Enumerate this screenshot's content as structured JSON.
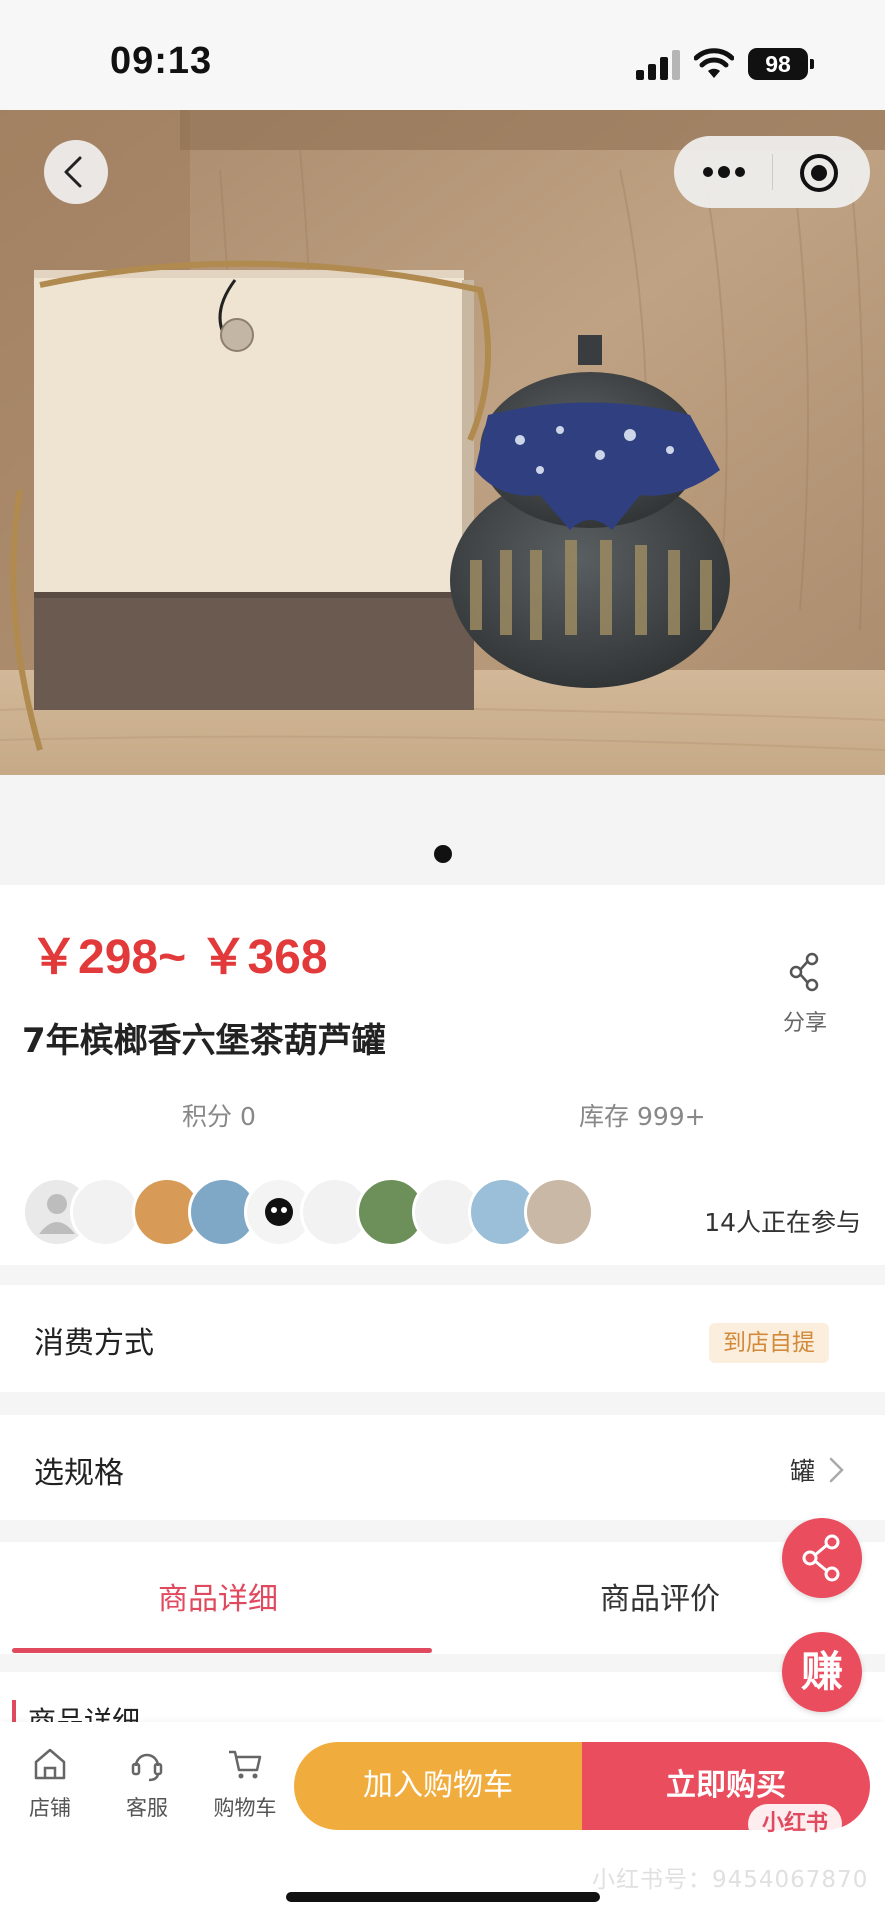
{
  "status_bar": {
    "time": "09:13",
    "battery": "98"
  },
  "gallery": {
    "image_count": 1,
    "current_index": 1
  },
  "product": {
    "price": "￥298~ ￥368",
    "title": "7年槟榔香六堡茶葫芦罐",
    "share_label": "分享",
    "points": "积分 0",
    "stock": "库存 999+",
    "participants": "14人正在参与"
  },
  "consumption": {
    "label": "消费方式",
    "badge": "到店自提"
  },
  "spec": {
    "label": "选规格",
    "value": "罐"
  },
  "tabs": [
    {
      "label": "商品详细",
      "active": true
    },
    {
      "label": "商品评价",
      "active": false
    }
  ],
  "detail": {
    "heading": "商品详细"
  },
  "float_buttons": {
    "earn_label": "赚"
  },
  "bottom_nav": [
    {
      "label": "店铺",
      "icon": "shop-icon"
    },
    {
      "label": "客服",
      "icon": "customer-service-icon"
    },
    {
      "label": "购物车",
      "icon": "cart-icon"
    }
  ],
  "actions": {
    "add_to_cart": "加入购物车",
    "buy_now": "立即购买"
  },
  "watermark": {
    "tag": "小红书",
    "id": "小红书号：9454067870"
  },
  "colors": {
    "price_red": "#e23a3a",
    "accent": "#ea4d5e",
    "cart_orange": "#f0ad3e",
    "badge_bg": "#fbeedd",
    "badge_text": "#d28a3a"
  }
}
